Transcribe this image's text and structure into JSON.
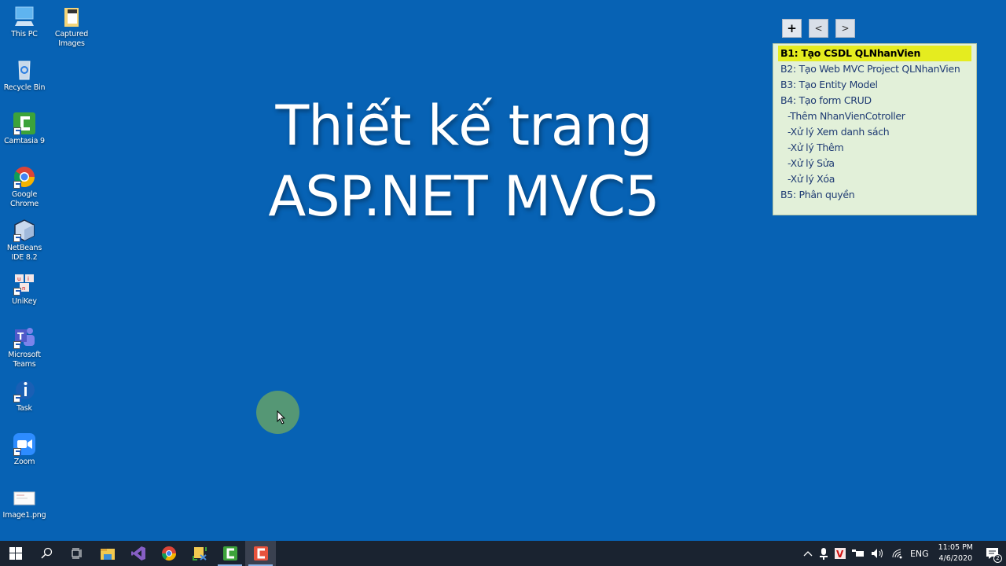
{
  "desktop": {
    "icons": [
      {
        "label": "This PC",
        "icon": "this-pc-icon"
      },
      {
        "label": "Captured Images",
        "icon": "folder-icon"
      },
      {
        "label": "Recycle Bin",
        "icon": "recycle-bin-icon"
      },
      {
        "label": "Camtasia 9",
        "icon": "camtasia-icon"
      },
      {
        "label": "Google Chrome",
        "icon": "chrome-icon"
      },
      {
        "label": "NetBeans IDE 8.2",
        "icon": "netbeans-icon"
      },
      {
        "label": "UniKey",
        "icon": "unikey-icon"
      },
      {
        "label": "Microsoft Teams",
        "icon": "teams-icon"
      },
      {
        "label": "Task",
        "icon": "task-icon"
      },
      {
        "label": "Zoom",
        "icon": "zoom-icon"
      },
      {
        "label": "Image1.png",
        "icon": "image-file-icon"
      }
    ]
  },
  "slide": {
    "title_line1": "Thiết kế trang",
    "title_line2": "ASP.NET MVC5"
  },
  "nav": {
    "add_label": "+",
    "prev_label": "<",
    "next_label": ">"
  },
  "outline": {
    "items": [
      {
        "label": "B1: Tạo CSDL QLNhanVien",
        "active": true
      },
      {
        "label": "B2: Tạo Web MVC Project QLNhanVien"
      },
      {
        "label": "B3: Tạo Entity Model"
      },
      {
        "label": "B4: Tạo form CRUD"
      },
      {
        "label": "-Thêm NhanVienCotroller",
        "sub": true
      },
      {
        "label": "-Xử lý Xem danh sách",
        "sub": true
      },
      {
        "label": "-Xử lý Thêm",
        "sub": true
      },
      {
        "label": "-Xử lý Sửa",
        "sub": true
      },
      {
        "label": "-Xử lý Xóa",
        "sub": true
      },
      {
        "label": "B5: Phân quyền"
      }
    ],
    "highlight_color": "#e5ec1f"
  },
  "taskbar": {
    "apps": [
      "start",
      "search",
      "task-view",
      "file-explorer",
      "visual-studio",
      "chrome",
      "snipping-tool",
      "camtasia-studio",
      "camtasia-recorder"
    ],
    "tray": {
      "language": "ENG",
      "time": "11:05 PM",
      "date": "4/6/2020",
      "notifications": "2"
    }
  },
  "colors": {
    "desktop_bg": "#0762b4",
    "taskbar_bg": "#1a2330",
    "outline_bg": "#e2f0d9"
  }
}
